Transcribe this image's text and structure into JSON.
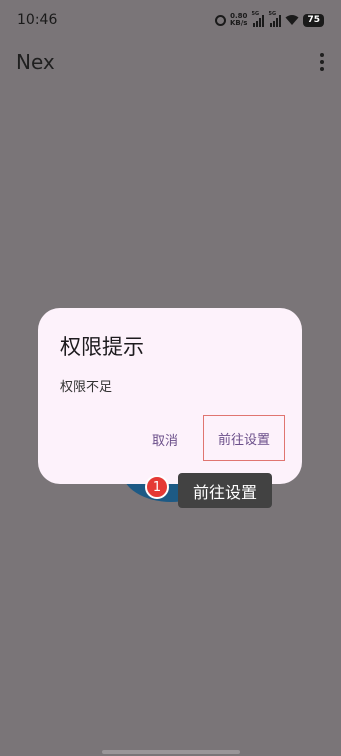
{
  "status_bar": {
    "time": "10:46",
    "net_speed_value": "0.80",
    "net_speed_unit": "KB/s",
    "sim1_label": "5G",
    "sim2_label": "5G",
    "battery": "75",
    "icons": [
      "alarm-icon",
      "signal-icon",
      "wifi-icon",
      "battery-icon"
    ]
  },
  "app_bar": {
    "title": "Nex",
    "menu_icon": "more-vert-icon"
  },
  "dialog": {
    "title": "权限提示",
    "message": "权限不足",
    "cancel_label": "取消",
    "confirm_label": "前往设置"
  },
  "overlay": {
    "step_number": "1",
    "hint_label": "前往设置",
    "highlight_color": "#e07570"
  },
  "colors": {
    "scrim": "#7a7578",
    "dialog_bg": "#fdf2fb",
    "button_text": "#6b4f8a",
    "fab": "#1d5a85",
    "badge": "#e53935"
  }
}
